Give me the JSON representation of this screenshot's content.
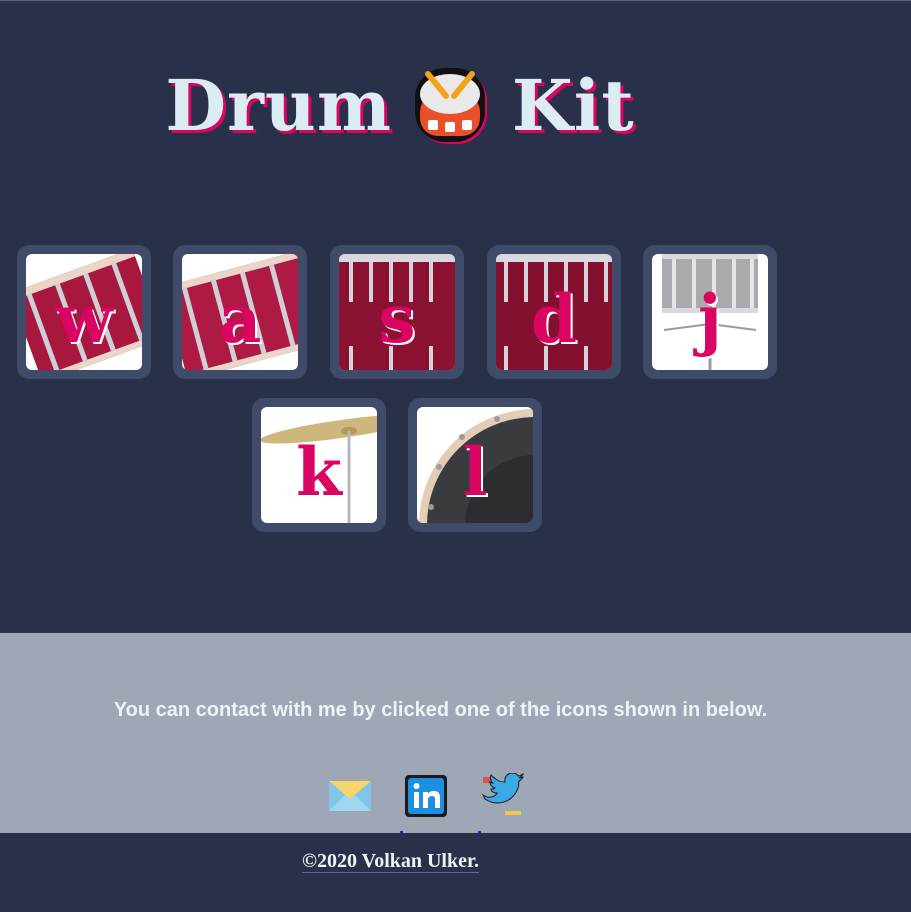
{
  "header": {
    "title_left": "Drum",
    "title_right": "Kit",
    "title_icon": "drum-emoji-icon"
  },
  "keys": [
    {
      "letter": "w",
      "instrument": "tom-1"
    },
    {
      "letter": "a",
      "instrument": "tom-2"
    },
    {
      "letter": "s",
      "instrument": "tom-3"
    },
    {
      "letter": "d",
      "instrument": "tom-4"
    },
    {
      "letter": "j",
      "instrument": "snare"
    },
    {
      "letter": "k",
      "instrument": "crash"
    },
    {
      "letter": "l",
      "instrument": "kick-bass"
    }
  ],
  "contact": {
    "text": "You can contact with me by clicked one of the icons shown in below.",
    "icons": [
      "mail-icon",
      "linkedin-icon",
      "twitter-icon"
    ]
  },
  "footer": {
    "copyright": "©2020 Volkan Ulker."
  },
  "colors": {
    "background": "#283149",
    "key_border": "#404b69",
    "accent": "#da0463",
    "title_text": "#dbedf3",
    "contact_background": "#9da7b5"
  }
}
